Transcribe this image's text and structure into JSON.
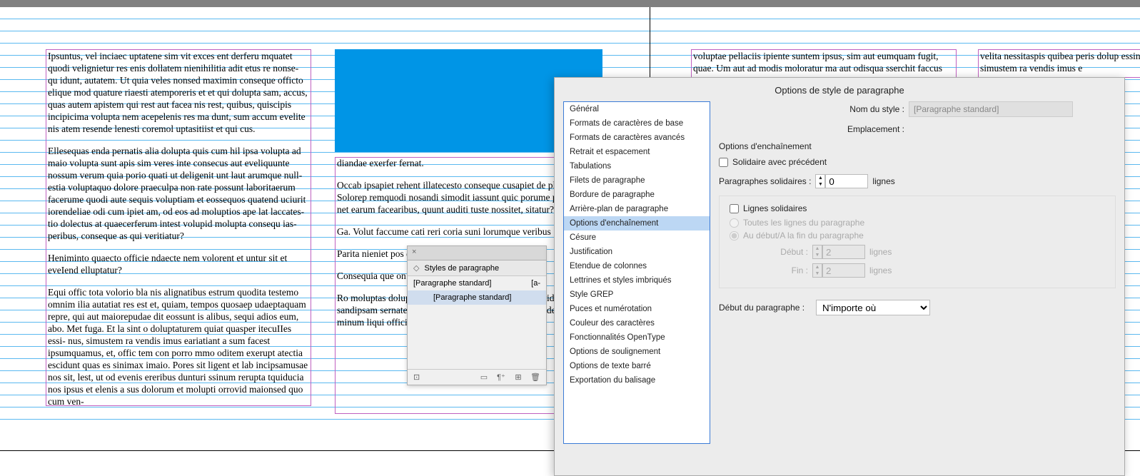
{
  "document": {
    "col1_p1": "Ipsuntus, vel inciaec uptatene sim vit exces ent derferu mquatet quodi velignietur res enis dollatem nienihilitia adit etus re nonse- qu idunt, autatem. Ut quia veles nonsed maximin conseque officto elique mod quature riaesti atemporeris et et qui dolupta sam, accus, quas autem apistem qui rest aut facea nis rest, quibus, quiscipis incipicima volupta nem acepelenis res ma dunt, sum accum evelite nis atem resende lenesti coremol uptasitiist et qui cus.",
    "col1_p2": "Ellesequas enda pernatis alia dolupta quis cum hil ipsa volupta ad maio volupta sunt apis sim veres inte consecus aut eveliquunte nossum verum quia porio quati ut deligenit unt laut arumque null- estia voluptaquo dolore praeculpa non rate possunt laboritaerum facerume quodi aute sequis voluptiam et eossequos quatend uciurit iorendeliae odi cum ipiet am, od eos ad moluptios ape lat laccates- tio dolectus at quaecerferum intest volupid molupta consequ ias- peribus, conseque as qui veritiatur?",
    "col1_p3": "Heniminto quaecto officie ndaecte nem volorent et untur sit et eveIend elluptatur?",
    "col1_p4": "Equi offic tota volorio bla nis alignatibus estrum quodita testemo omnim ilia autatiat res est et, quiam, tempos quosaep udaeptaquam repre, qui aut maiorepudae dit eossunt is alibus, sequi adios eum, abo. Met fuga. Et la sint o doluptaturem quiat quasper itecuIIes essi- nus, simustem ra vendis imus eariatiant a sum facest ipsumquamus, et, offic tem con porro mmo oditem exerupt atectia escidunt quas es sinimax imaio. Pores sit ligent et lab incipsamusae nos sit, lest, ut od evenis ereribus dunturi ssinum rerupta tquiducia nos ipsus et elenis a sus dolorum et molupti orrovid maionsed quo cum ven-",
    "col2_p1": "diandae exerfer fernat.",
    "col2_p2": "Occab ipsapiet rehent illatecesto conseque cusapiet de plabo. Solorep remquodi nosandi simodit iassunt quic porume parumque net earum facearibus, quunt auditi tuste nossitet, sitatur?",
    "col2_p3": "Ga. Volut faccume cati reri coria suni lorumque veribus",
    "col2_p4": "Parita nieniet pos dem vel idebit re c",
    "col2_p5": "Consequia que on plique laboritatia siminus tendicat.",
    "col2_p6": "Ro moluptas dolupitas magnis santeminodi aut pora n idercip sandipsam sernate cessequam earchil in renton eius et derepercid minum liqui officitionsed quo omni",
    "page2_col1": "voluptae pellaciis ipiente suntem ipsus, sim aut eumquam fugit, quae. Um aut ad modis moloratur ma aut odisqua sserchit faccus",
    "page2_col2": "velita nessitaspis quibea peris dolup essinus, simustem ra vendis imus e"
  },
  "styles_panel": {
    "title": "Styles de paragraphe",
    "row_default": "[Paragraphe standard]",
    "row_default_suffix": "[a-",
    "row_selected": "[Paragraphe standard]"
  },
  "dialog": {
    "title": "Options de style de paragraphe",
    "categories": [
      "Général",
      "Formats de caractères de base",
      "Formats de caractères avancés",
      "Retrait et espacement",
      "Tabulations",
      "Filets de paragraphe",
      "Bordure de paragraphe",
      "Arrière-plan de paragraphe",
      "Options d'enchaînement",
      "Césure",
      "Justification",
      "Etendue de colonnes",
      "Lettrines et styles imbriqués",
      "Style GREP",
      "Puces et numérotation",
      "Couleur des caractères",
      "Fonctionnalités OpenType",
      "Options de soulignement",
      "Options de texte barré",
      "Exportation du balisage"
    ],
    "selected_category_index": 8,
    "name_label": "Nom du style :",
    "name_value": "[Paragraphe standard]",
    "location_label": "Emplacement :",
    "section_title": "Options d'enchaînement",
    "keep_with_prev": "Solidaire avec précédent",
    "keep_with_next_label": "Paragraphes solidaires :",
    "keep_with_next_value": "0",
    "lines_unit": "lignes",
    "keep_lines_together": "Lignes solidaires",
    "radio_all": "Toutes les lignes du paragraphe",
    "radio_startend": "Au début/A la fin du paragraphe",
    "start_label": "Début :",
    "start_value": "2",
    "end_label": "Fin :",
    "end_value": "2",
    "para_start_label": "Début du paragraphe :",
    "para_start_value": "N'importe où"
  }
}
